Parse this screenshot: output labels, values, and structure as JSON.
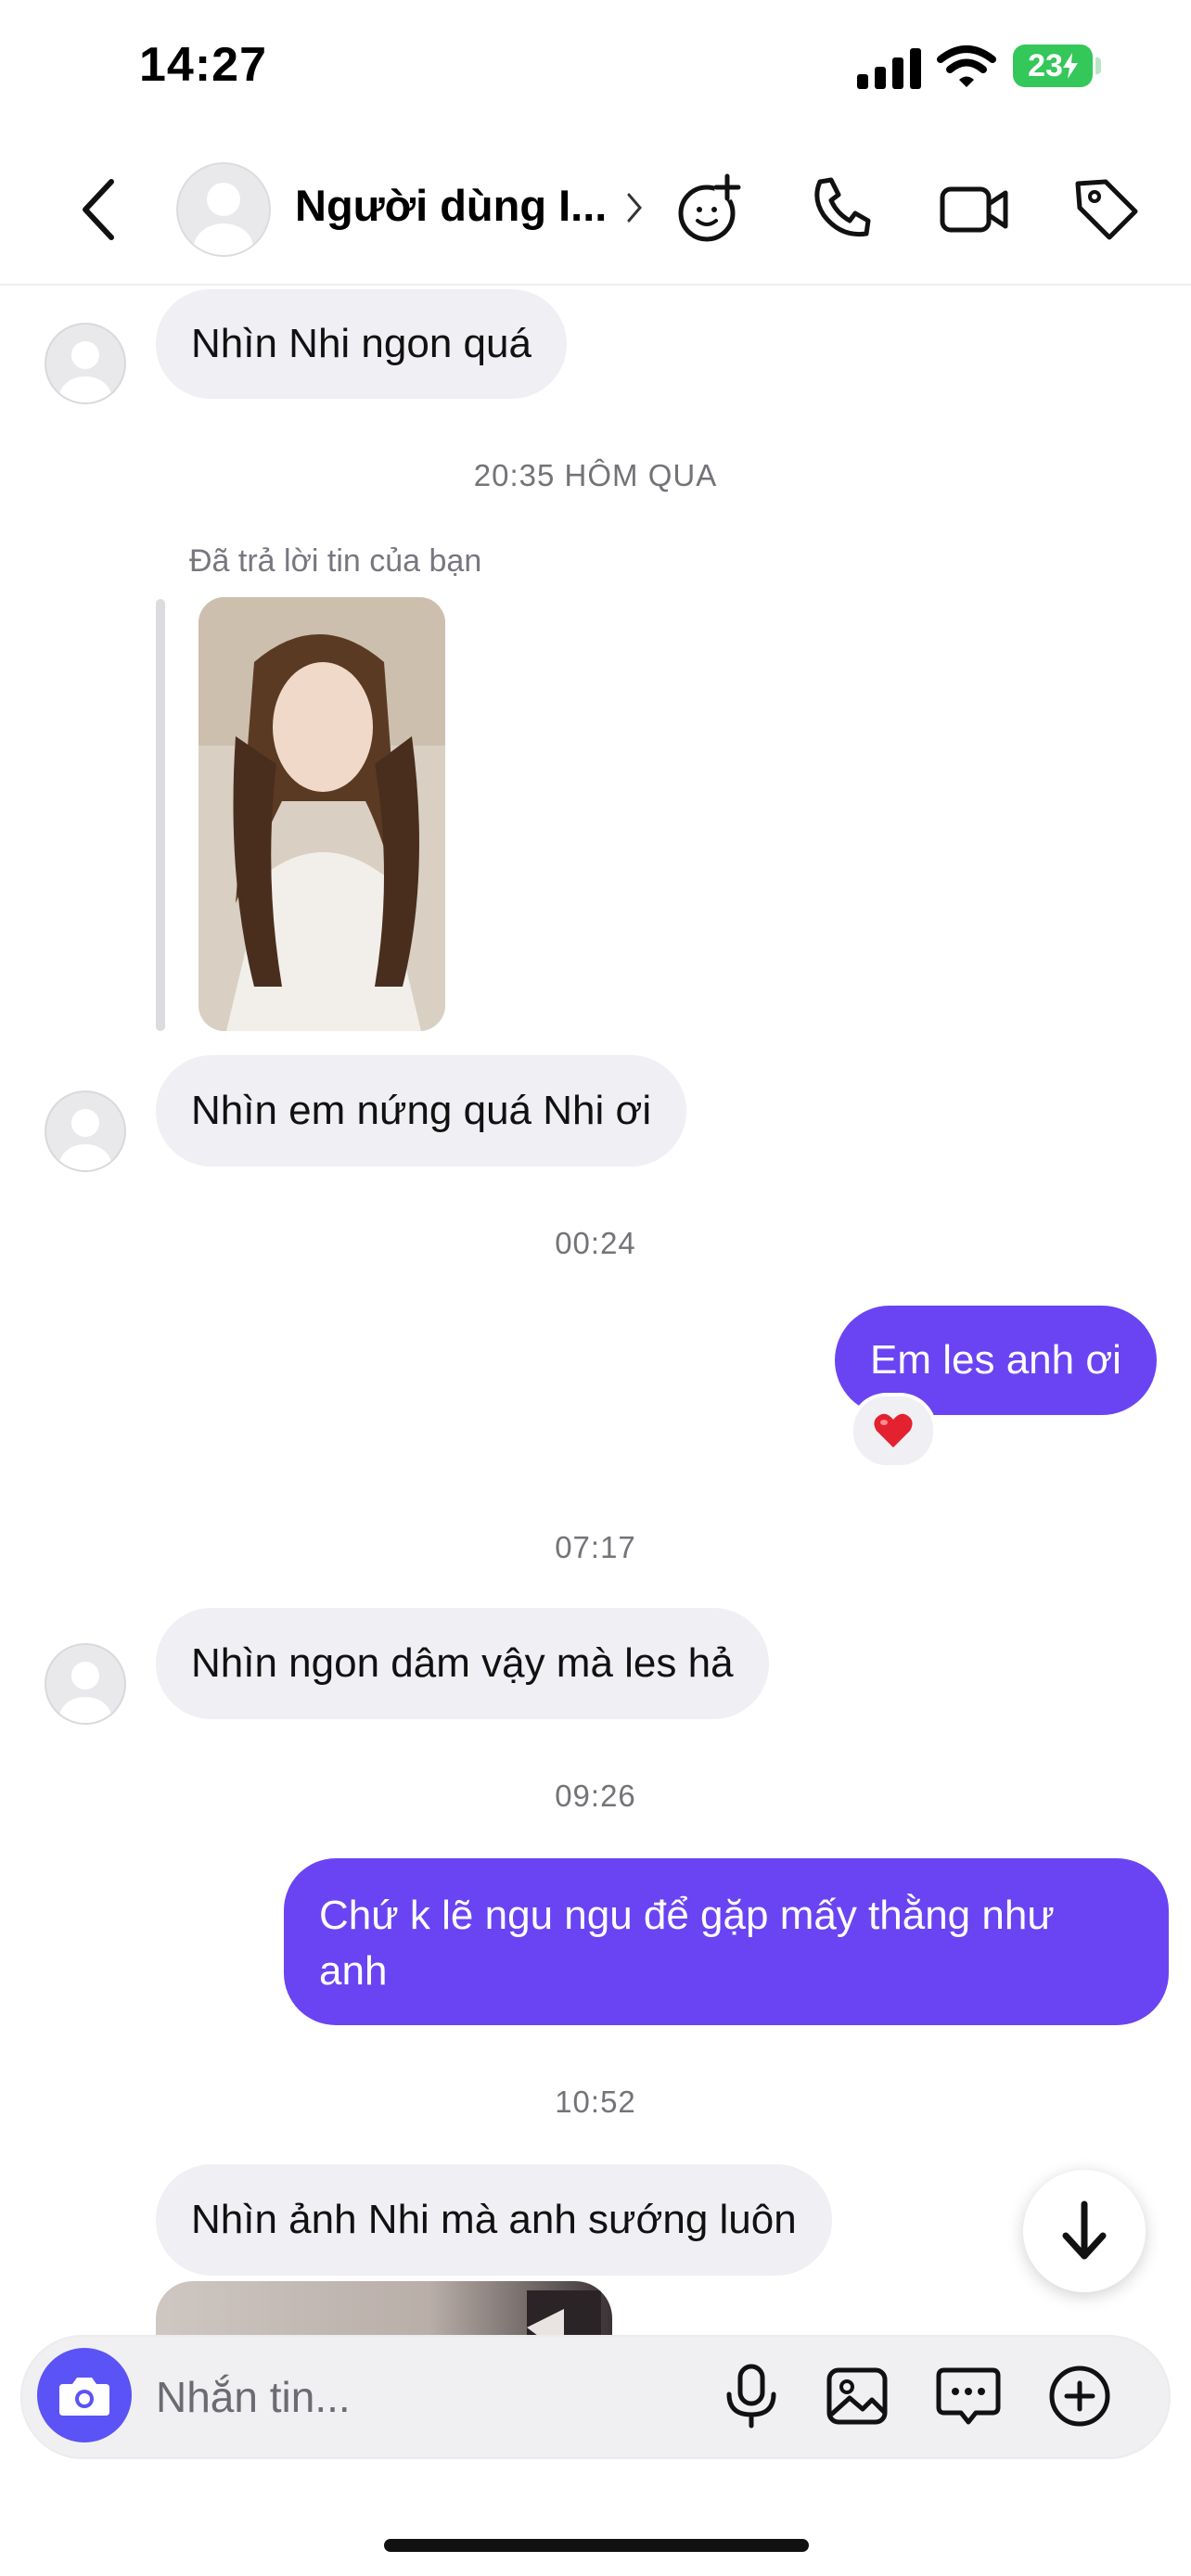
{
  "status_bar": {
    "time": "14:27",
    "battery": "23"
  },
  "header": {
    "contact_name": "Người dùng I..."
  },
  "messages": [
    {
      "text": "Nhìn Nhi ngon quá"
    },
    {
      "text": "Nhìn em nứng quá Nhi ơi"
    },
    {
      "text": "Em les anh ơi"
    },
    {
      "text": "Nhìn ngon dâm vậy mà les hả"
    },
    {
      "text": "Chứ k lẽ ngu ngu để gặp mấy thằng như anh"
    },
    {
      "text": "Nhìn ảnh Nhi mà anh sướng luôn"
    }
  ],
  "timestamps": [
    "20:35 HÔM QUA",
    "00:24",
    "07:17",
    "09:26",
    "10:52"
  ],
  "reply": {
    "label": "Đã trả lời tin của bạn"
  },
  "composer": {
    "placeholder": "Nhắn tin..."
  },
  "colors": {
    "outgoing_bubble": "#6a44f2",
    "incoming_bubble": "#efeff4",
    "camera_button": "#5b53f5",
    "battery": "#34c759"
  },
  "icons": [
    "back-icon",
    "add-person-icon",
    "phone-icon",
    "video-icon",
    "tag-icon",
    "camera-icon",
    "mic-icon",
    "image-icon",
    "chat-bubble-icon",
    "plus-circle-icon",
    "arrow-down-icon",
    "heart-icon"
  ]
}
